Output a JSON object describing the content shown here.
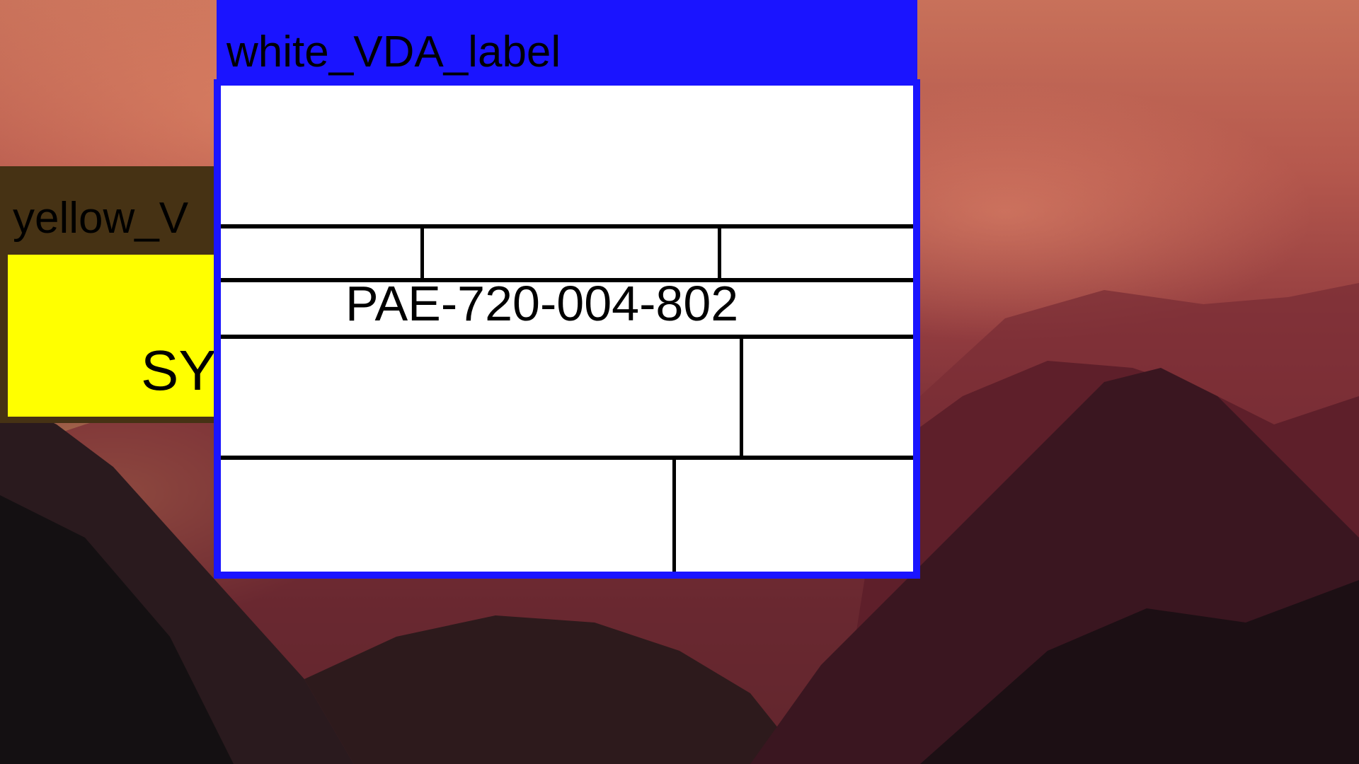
{
  "windows": {
    "yellow": {
      "title": "yellow_V",
      "content_text": "SY",
      "colors": {
        "content": "#ffff00",
        "frame": "#463214"
      }
    },
    "white": {
      "title": "white_VDA_label",
      "part_number": "PAE-720-004-802",
      "colors": {
        "titlebar": "#1a14ff",
        "content": "#ffffff"
      }
    }
  },
  "background": {
    "type": "wallpaper",
    "subject": "mountain-valley-sunset"
  }
}
